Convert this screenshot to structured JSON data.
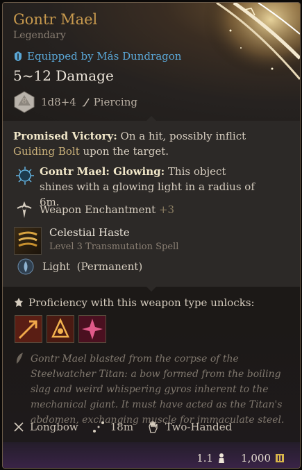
{
  "item": {
    "name": "Gontr Mael",
    "rarity": "Legendary",
    "equipped": "Equipped by Más Dundragon",
    "damage": "5~12 Damage",
    "die_face": "8",
    "dice": "1d8+4",
    "damage_type": "Piercing"
  },
  "passives": {
    "promised_name": "Promised Victory:",
    "promised_text_a": " On a hit, possibly inflict ",
    "promised_link": "Guiding Bolt",
    "promised_text_b": " upon the target.",
    "glowing_name": "Gontr Mael: Glowing:",
    "glowing_text": " This object shines with a glowing light in a radius of 6m.",
    "enchant_label": "Weapon Enchantment",
    "enchant_value": "+3",
    "spell_name": "Celestial Haste",
    "spell_sub": "Level 3 Transmutation Spell",
    "light_label": "Light",
    "light_sub": "(Permanent)"
  },
  "proficiency": {
    "heading": "Proficiency with this weapon type unlocks:",
    "actions": [
      "piercing-shot-icon",
      "mobile-shot-icon",
      "hamstring-shot-icon"
    ]
  },
  "lore": "Gontr Mael blasted from the corpse of the Steelwatcher Titan: a bow formed from the boiling slag and weird whispering gyros inherent to the mechanical giant. It must have acted as the Titan's abdomen, exchanging muscle for immaculate steel.",
  "properties": {
    "type": "Longbow",
    "range": "18m",
    "handedness": "Two-Handed"
  },
  "footer": {
    "weight": "1.1",
    "value": "1,000"
  },
  "colors": {
    "title": "#c89a4e",
    "equipped": "#5aa7d6",
    "keyword": "#c9b07a"
  }
}
